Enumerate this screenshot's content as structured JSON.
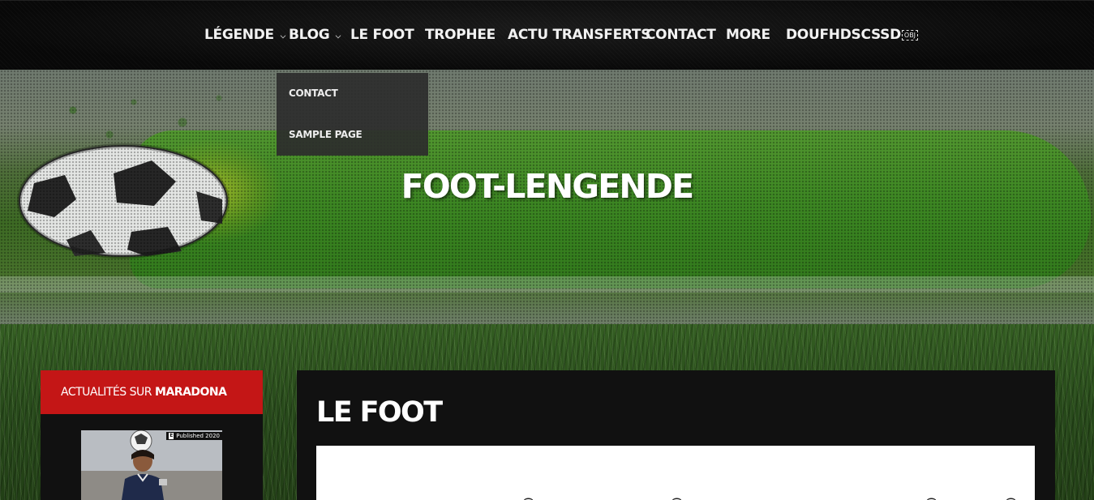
{
  "nav": {
    "items": [
      {
        "label": "Légende",
        "has_dropdown": true
      },
      {
        "label": "Blog",
        "has_dropdown": true
      },
      {
        "label": "Le Foot",
        "has_dropdown": false
      },
      {
        "label": "Trophee",
        "has_dropdown": false
      },
      {
        "label": "Actu Transferts",
        "has_dropdown": false
      },
      {
        "label": "Contact",
        "has_dropdown": false
      },
      {
        "label": "More",
        "has_dropdown": false
      },
      {
        "label": "Doufhdscssd",
        "has_dropdown": false,
        "trailing_glyph": "OBJ"
      }
    ],
    "dropdown": {
      "parent": "Blog",
      "items": [
        {
          "label": "Contact"
        },
        {
          "label": "Sample Page"
        }
      ]
    }
  },
  "hero": {
    "site_title": "FOOT-LENGENDE"
  },
  "sidebar": {
    "widget_title_prefix": "Actualités sur",
    "widget_title_highlight": "Maradona",
    "thumbnail": {
      "badge": "Published 2020",
      "badge_mark": "E"
    }
  },
  "main": {
    "article_title": "LE FOOT"
  },
  "colors": {
    "accent_red": "#c41616",
    "nav_bg": "#0b0b0b",
    "panel_bg": "#111111",
    "grass": "#2c5220"
  }
}
